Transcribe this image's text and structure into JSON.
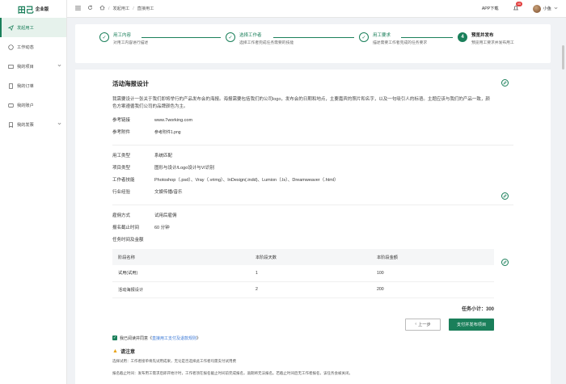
{
  "brand": {
    "logo_text": "田己",
    "edition": "企业版"
  },
  "sidebar": {
    "items": [
      {
        "label": "发起用工",
        "active": true
      },
      {
        "label": "工作动态"
      },
      {
        "label": "我的项目",
        "has_children": true
      },
      {
        "label": "我的订单"
      },
      {
        "label": "我的账户"
      },
      {
        "label": "我的发票",
        "has_children": true
      }
    ]
  },
  "topbar": {
    "breadcrumb": [
      "发起用工",
      "直接用工"
    ],
    "app_download": "APP下载",
    "notification_count": "45",
    "username": "小鱼"
  },
  "steps": [
    {
      "num": "✓",
      "title": "用工内容",
      "desc": "对用工内容进行描述"
    },
    {
      "num": "✓",
      "title": "选择工作者",
      "desc": "选择工作者完成任务需要的技能"
    },
    {
      "num": "✓",
      "title": "用工要求",
      "desc": "描述需要工作者完成的任务要求"
    },
    {
      "num": "4",
      "title": "预览并发布",
      "desc": "预览用工要求并发布用工"
    }
  ],
  "project": {
    "title": "活动海报设计",
    "description": "我需要设计一张关于我们即将举行的产品发布会的海报。海报需要包括我们的公司logo，发布会的日期和地点，主要嘉宾的照片和名字，以及一句吸引人的标语。主题应该与我们的产品一致，颜色方案遵循我们公司的品牌颜色为主。",
    "ref_link_label": "参考链接",
    "ref_link": "www.7working.com",
    "ref_file_label": "参考附件",
    "ref_file": "参考附件1.png"
  },
  "job": {
    "type_label": "用工类型",
    "type": "系统匹配",
    "category_label": "项目类型",
    "category": "图形与设计/Logo设计与VI识别",
    "skills_label": "工作者技能",
    "skills": "Photoshop（.psd）、Vray（.vrimg）、InDesign(.indd)、Lumion（.ls）、Dreamweaver（.html）",
    "industry_label": "行业经验",
    "industry": "文娱传播/音乐"
  },
  "hire": {
    "mode_label": "雇佣方式",
    "mode": "试用后雇佣",
    "deadline_label": "报名截止时间",
    "deadline": "60 分钟",
    "task_time_label": "任务时间及金额",
    "table_headers": [
      "阶段名称",
      "本阶段天数",
      "本阶段金额"
    ],
    "rows": [
      [
        "试用(试用)",
        "1",
        "100"
      ],
      [
        "活动海报设计",
        "2",
        "200"
      ]
    ],
    "total": "任务小计：300"
  },
  "actions": {
    "prev": "上一步",
    "publish": "支付并发布项目"
  },
  "agreement": {
    "prefix": "我已阅读并同意《",
    "link": "直接用工支付及退款规则",
    "suffix": "》"
  },
  "notice": {
    "title": "请注意",
    "lines": [
      "选择试用：工作者接单将先试用成果，无论是否选择此工作者均需支付试用费",
      "报名截止时间：发布用工需求后即开始计时，工作者须在报名截止时间前完成报名，逾期将无法报名。若截止时间后无工作者报名，该任务会被关闭。"
    ]
  },
  "colors": {
    "primary": "#1a7f5a",
    "link": "#3a78d6",
    "badge": "#e23c3c"
  }
}
